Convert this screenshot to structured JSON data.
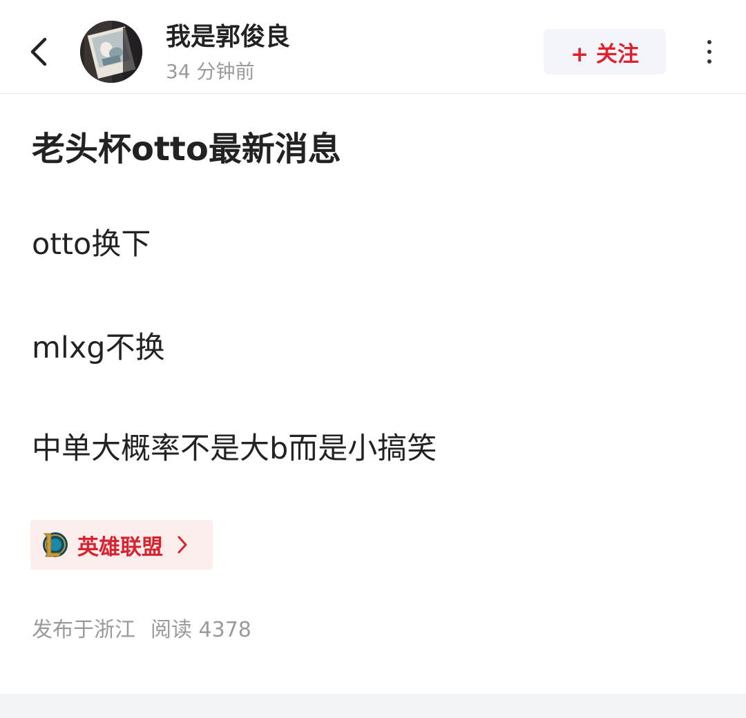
{
  "header": {
    "author_name": "我是郭俊良",
    "post_time": "34 分钟前",
    "follow_label": "+ 关注",
    "back_icon": "chevron-left-icon",
    "more_icon": "vertical-ellipsis-icon"
  },
  "post": {
    "title": "老头杯otto最新消息",
    "paragraphs": [
      "otto换下",
      "mlxg不换",
      "中单大概率不是大b而是小搞笑"
    ],
    "topic": {
      "label": "英雄联盟",
      "icon": "league-of-legends-logo"
    },
    "location": "发布于浙江",
    "read_count": "阅读 4378"
  },
  "colors": {
    "accent_red": "#e0202b",
    "topic_bg": "#fdeeee",
    "muted_text": "#9a9a9a",
    "follow_bg": "#f4f5fa"
  }
}
